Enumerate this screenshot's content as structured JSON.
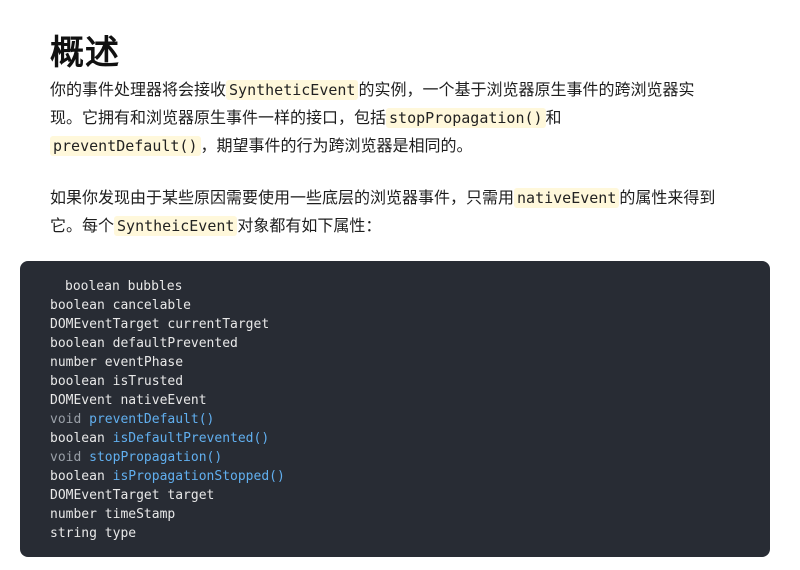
{
  "title": "概述",
  "paragraph1": {
    "line1": {
      "text_a": "你的事件处理器将会接收",
      "code": "SyntheticEvent",
      "text_b": "的实例，一个基于浏览器原生事件的跨浏览器实"
    },
    "line2": {
      "text_a": "现。它拥有和浏览器原生事件一样的接口，包括",
      "code": "stopPropagation()",
      "text_b": "和"
    },
    "line3": {
      "code": "preventDefault()",
      "text_b": "，期望事件的行为跨浏览器是相同的。"
    }
  },
  "paragraph2": {
    "line1": {
      "text_a": "如果你发现由于某些原因需要使用一些底层的浏览器事件，只需用",
      "code": "nativeEvent",
      "text_b": "的属性来得到"
    },
    "line2": {
      "text_a": "它。每个",
      "code": "SyntheicEvent",
      "text_b": "对象都有如下属性："
    }
  },
  "code_block": {
    "lines": [
      {
        "type": "boolean",
        "name": "bubbles",
        "is_method": false
      },
      {
        "type": "boolean",
        "name": "cancelable",
        "is_method": false
      },
      {
        "type": "DOMEventTarget",
        "name": "currentTarget",
        "is_method": false
      },
      {
        "type": "boolean",
        "name": "defaultPrevented",
        "is_method": false
      },
      {
        "type": "number",
        "name": "eventPhase",
        "is_method": false
      },
      {
        "type": "boolean",
        "name": "isTrusted",
        "is_method": false
      },
      {
        "type": "DOMEvent",
        "name": "nativeEvent",
        "is_method": false
      },
      {
        "type": "void",
        "name": "preventDefault()",
        "is_method": true
      },
      {
        "type": "boolean",
        "name": "isDefaultPrevented()",
        "is_method": true
      },
      {
        "type": "void",
        "name": "stopPropagation()",
        "is_method": true
      },
      {
        "type": "boolean",
        "name": "isPropagationStopped()",
        "is_method": true
      },
      {
        "type": "DOMEventTarget",
        "name": "target",
        "is_method": false
      },
      {
        "type": "number",
        "name": "timeStamp",
        "is_method": false
      },
      {
        "type": "string",
        "name": "type",
        "is_method": false
      }
    ]
  },
  "colors": {
    "code_bg": "#282c34",
    "inline_code_bg": "#fff8db",
    "method_color": "#61afef"
  }
}
